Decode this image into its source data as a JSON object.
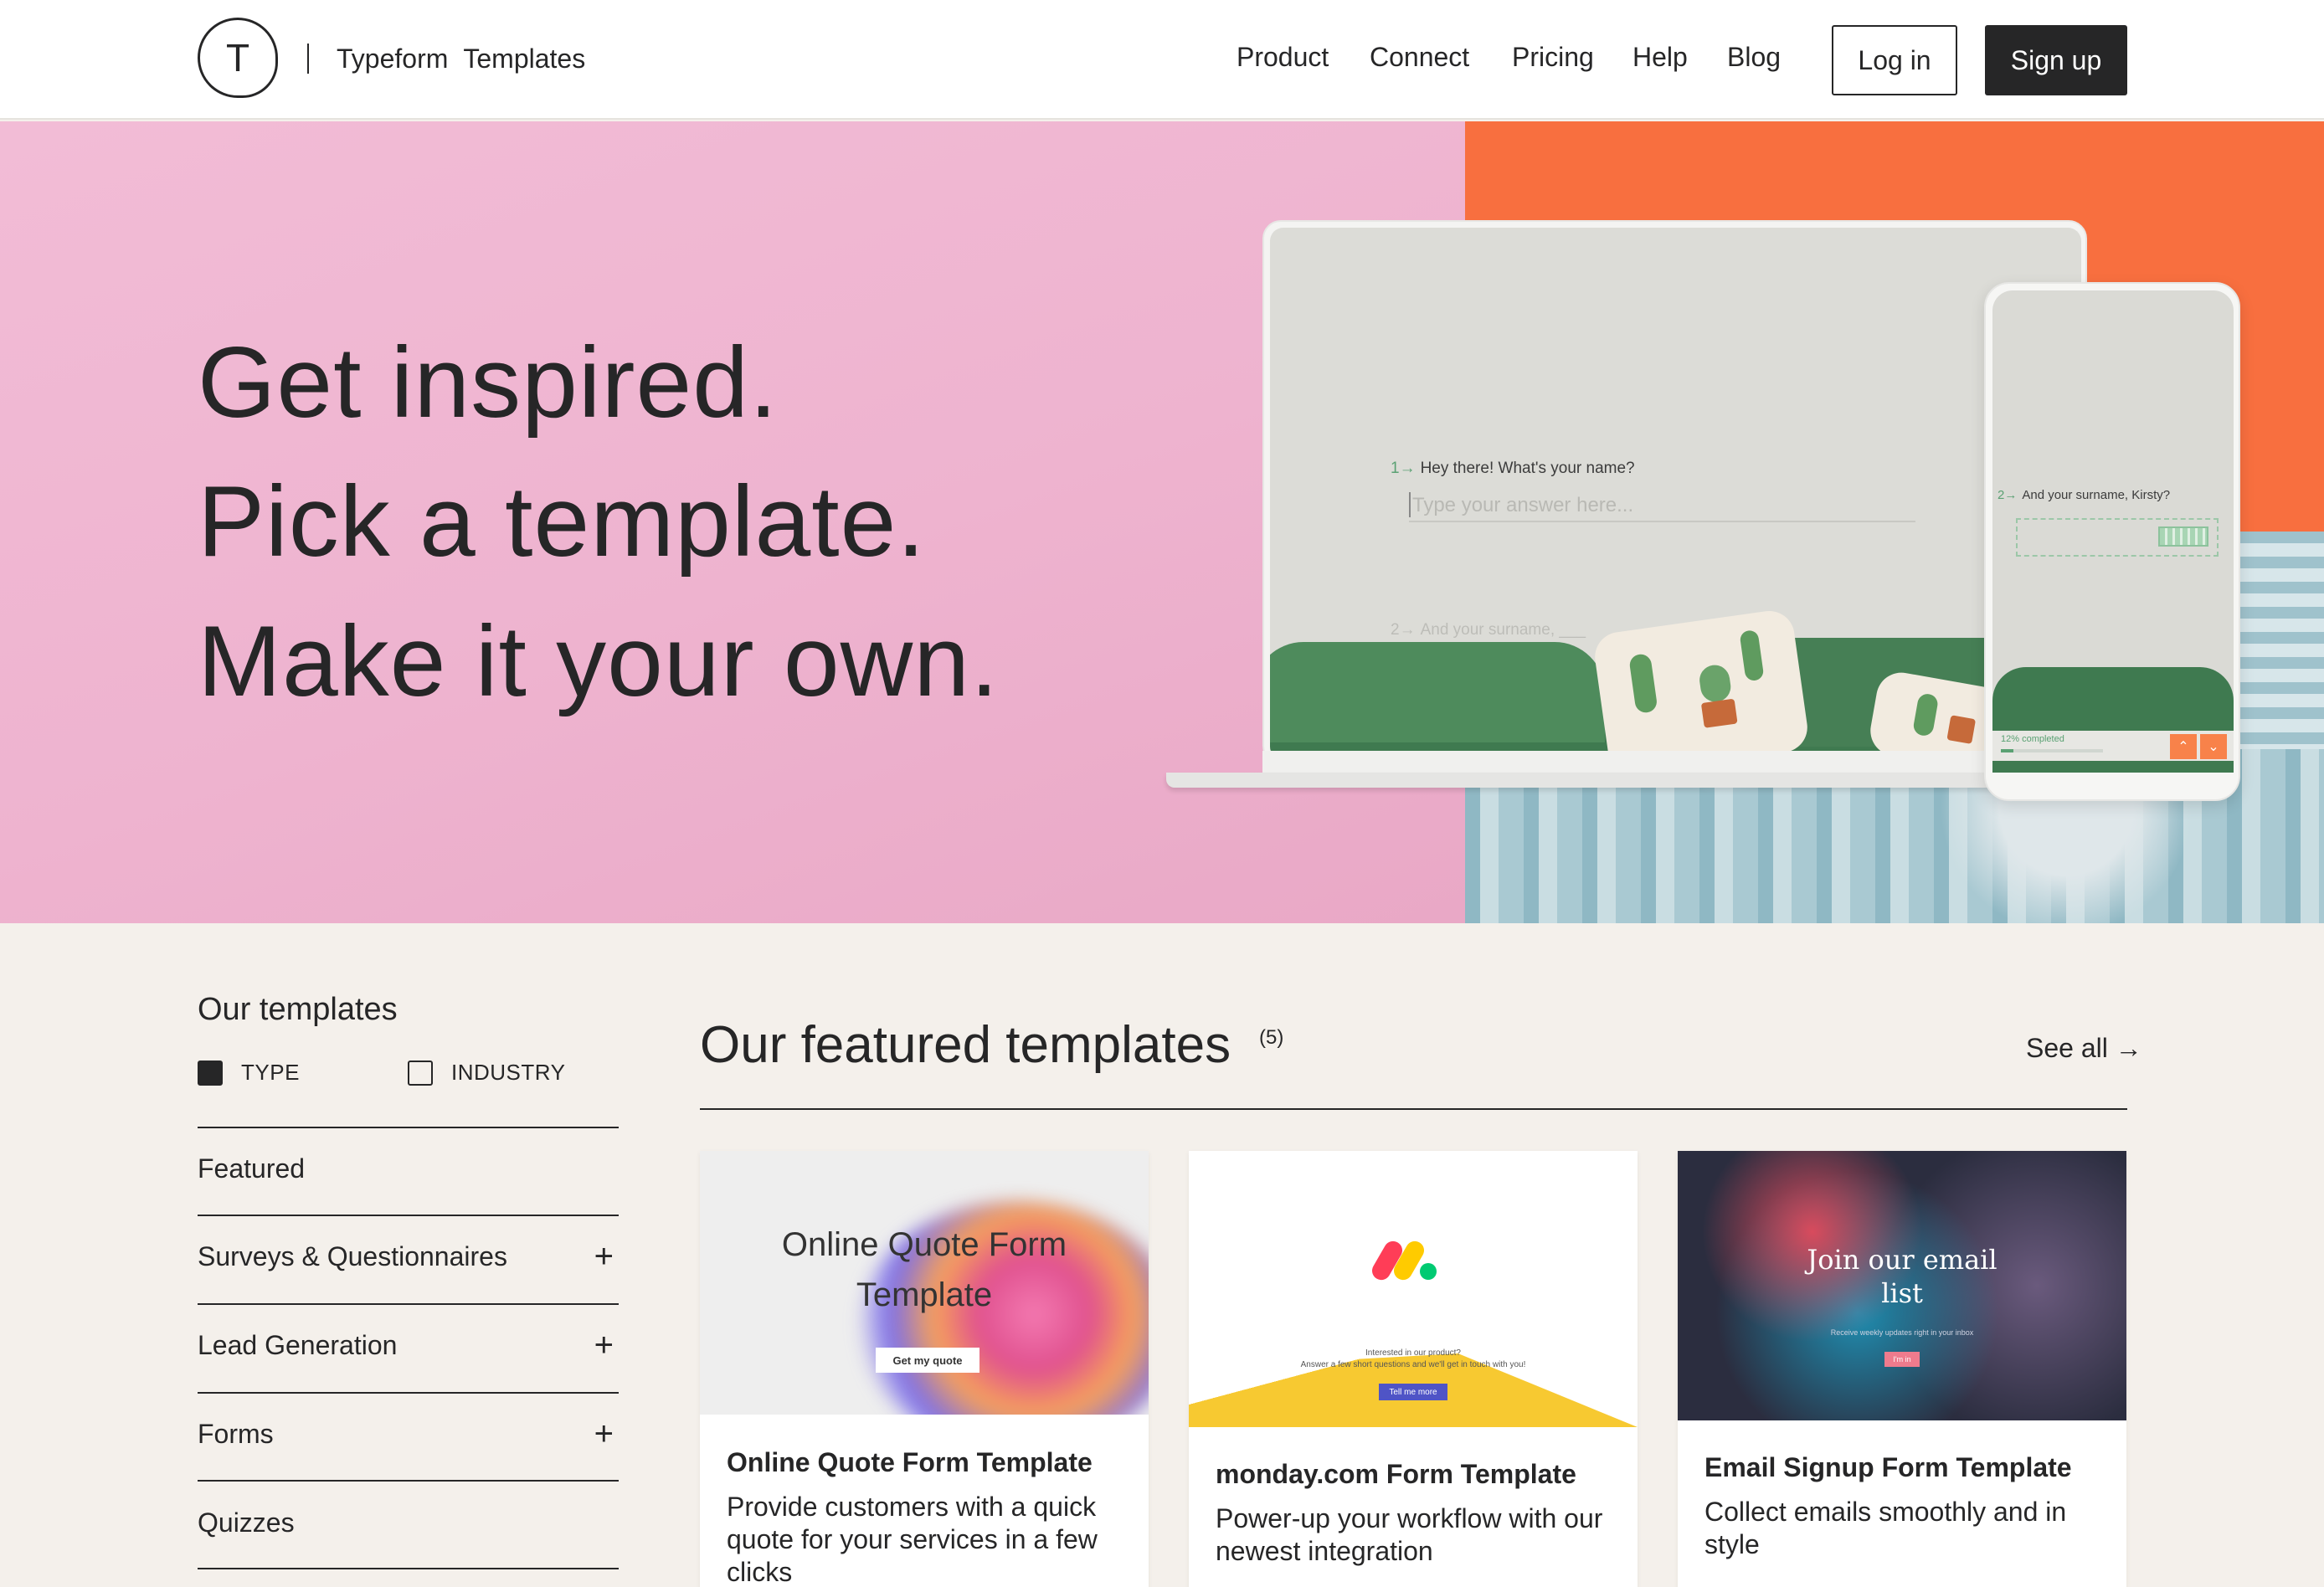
{
  "header": {
    "logo_letter": "T",
    "brand": "Typeform",
    "brand_section": "Templates",
    "nav": [
      "Product",
      "Connect",
      "Pricing",
      "Help",
      "Blog"
    ],
    "login_label": "Log in",
    "signup_label": "Sign up"
  },
  "hero": {
    "headline": [
      "Get inspired.",
      "Pick a template.",
      "Make it your own."
    ],
    "laptop": {
      "q1_num": "1→",
      "q1": "Hey there! What's your name?",
      "q1_placeholder": "Type your answer here...",
      "q2_num": "2→",
      "q2": "And your surname, ___"
    },
    "phone": {
      "q_num": "2→",
      "q": "And your surname, Kirsty?",
      "progress_text": "12% completed",
      "progress": 0.12
    },
    "colors": {
      "pink": "#eeb3cf",
      "orange": "#f86f3f"
    }
  },
  "sidebar": {
    "title": "Our templates",
    "filters": [
      {
        "label": "TYPE",
        "checked": true
      },
      {
        "label": "INDUSTRY",
        "checked": false
      }
    ],
    "items": [
      {
        "label": "Featured",
        "expandable": false
      },
      {
        "label": "Surveys & Questionnaires",
        "expandable": true
      },
      {
        "label": "Lead Generation",
        "expandable": true
      },
      {
        "label": "Forms",
        "expandable": true
      },
      {
        "label": "Quizzes",
        "expandable": false
      }
    ],
    "plus_icon": "+"
  },
  "featured": {
    "title": "Our featured templates",
    "count": "(5)",
    "see_all": "See all →",
    "cards": [
      {
        "title": "Online Quote Form Template",
        "desc": "Provide customers with a quick quote for your services in a few clicks",
        "thumb_heading": "Online Quote Form Template",
        "thumb_button": "Get my quote"
      },
      {
        "title": "monday.com Form Template",
        "desc": "Power-up your workflow with our newest integration",
        "thumb_line1": "Interested in our product?",
        "thumb_line2": "Answer a few short questions and we'll get in touch with you!",
        "thumb_button": "Tell me more"
      },
      {
        "title": "Email Signup Form Template",
        "desc": "Collect emails smoothly and in style",
        "thumb_heading": "Join our email list",
        "thumb_sub": "Receive weekly updates right in your inbox",
        "thumb_button": "I'm in"
      }
    ]
  }
}
